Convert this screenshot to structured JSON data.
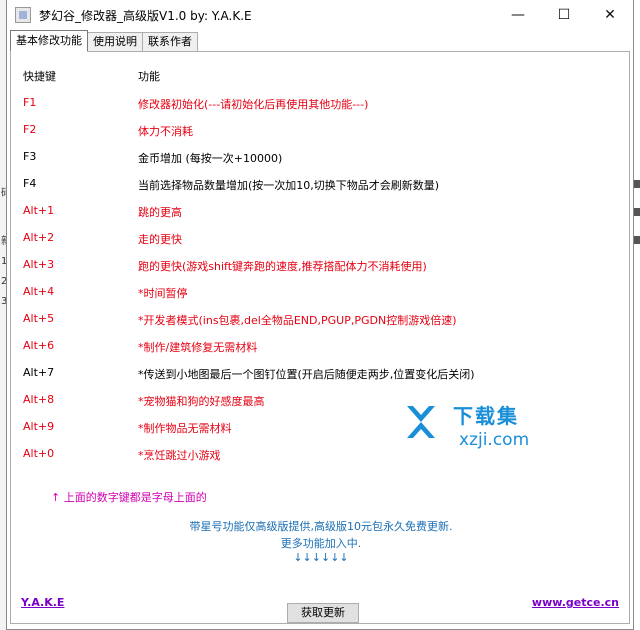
{
  "window": {
    "title": "梦幻谷_修改器_高级版V1.0 by: Y.A.K.E",
    "controls": {
      "minimize": "—",
      "maximize": "☐",
      "close": "✕"
    }
  },
  "tabs": [
    {
      "label": "基本修改功能",
      "active": true
    },
    {
      "label": "使用说明",
      "active": false
    },
    {
      "label": "联系作者",
      "active": false
    }
  ],
  "table": {
    "header": {
      "key": "快捷键",
      "function": "功能"
    },
    "rows": [
      {
        "key": "F1",
        "function": "修改器初始化(---请初始化后再使用其他功能---)",
        "color": "#e60012"
      },
      {
        "key": "F2",
        "function": "体力不消耗",
        "color": "#e60012"
      },
      {
        "key": "F3",
        "function": "金币增加 (每按一次+10000)",
        "color": "#000000"
      },
      {
        "key": "F4",
        "function": "当前选择物品数量增加(按一次加10,切换下物品才会刷新数量)",
        "color": "#000000"
      },
      {
        "key": "Alt+1",
        "function": "跳的更高",
        "color": "#e60012"
      },
      {
        "key": "Alt+2",
        "function": "走的更快",
        "color": "#e60012"
      },
      {
        "key": "Alt+3",
        "function": "跑的更快(游戏shift键奔跑的速度,推荐搭配体力不消耗使用)",
        "color": "#e60012"
      },
      {
        "key": "Alt+4",
        "function": "*时间暂停",
        "color": "#e60012"
      },
      {
        "key": "Alt+5",
        "function": "*开发者模式(ins包裹,del全物品END,PGUP,PGDN控制游戏倍速)",
        "color": "#e60012"
      },
      {
        "key": "Alt+6",
        "function": "*制作/建筑修复无需材料",
        "color": "#e60012"
      },
      {
        "key": "Alt+7",
        "function": "*传送到小地图最后一个图钉位置(开启后随便走两步,位置变化后关闭)",
        "color": "#000000"
      },
      {
        "key": "Alt+8",
        "function": "*宠物猫和狗的好感度最高",
        "color": "#e60012"
      },
      {
        "key": "Alt+9",
        "function": "*制作物品无需材料",
        "color": "#e60012"
      },
      {
        "key": "Alt+0",
        "function": "*烹饪跳过小游戏",
        "color": "#e60012"
      }
    ]
  },
  "note": "↑ 上面的数字键都是字母上面的",
  "info_lines": [
    "带星号功能仅高级版提供,高级版10元包永久免费更新.",
    "更多功能加入中.",
    "↓↓↓↓↓↓"
  ],
  "watermark": {
    "big": "下载集",
    "small": "xzji.com"
  },
  "footer": {
    "left_link": "Y.A.K.E",
    "right_link": "www.getce.cn",
    "update_button": "获取更新"
  },
  "colors": {
    "red": "#e60012",
    "note": "#d000b0",
    "info": "#1a6fb4",
    "link": "#7a00c8"
  }
}
